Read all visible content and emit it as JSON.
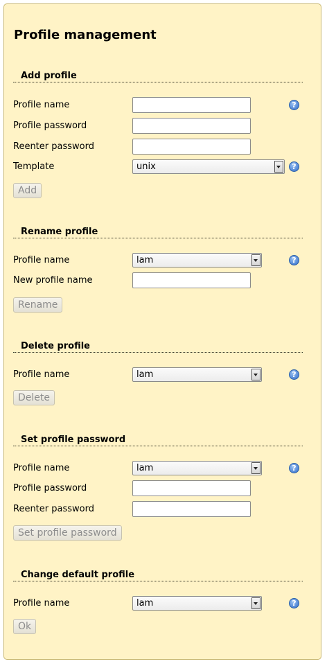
{
  "page": {
    "title": "Profile management"
  },
  "add": {
    "title": "Add profile",
    "name_label": "Profile name",
    "password_label": "Profile password",
    "reenter_label": "Reenter password",
    "template_label": "Template",
    "template_value": "unix",
    "button": "Add"
  },
  "rename": {
    "title": "Rename profile",
    "name_label": "Profile name",
    "name_value": "lam",
    "new_name_label": "New profile name",
    "button": "Rename"
  },
  "delete": {
    "title": "Delete profile",
    "name_label": "Profile name",
    "name_value": "lam",
    "button": "Delete"
  },
  "setpass": {
    "title": "Set profile password",
    "name_label": "Profile name",
    "name_value": "lam",
    "password_label": "Profile password",
    "reenter_label": "Reenter password",
    "button": "Set profile password"
  },
  "default": {
    "title": "Change default profile",
    "name_label": "Profile name",
    "name_value": "lam",
    "button": "Ok"
  },
  "help_glyph": "?",
  "icons": {
    "help": "help-icon",
    "dropdown": "chevron-down-icon"
  },
  "colors": {
    "panel_bg": "#fff3c6",
    "panel_border": "#c9b873",
    "help_icon": "#2f6bc9"
  }
}
